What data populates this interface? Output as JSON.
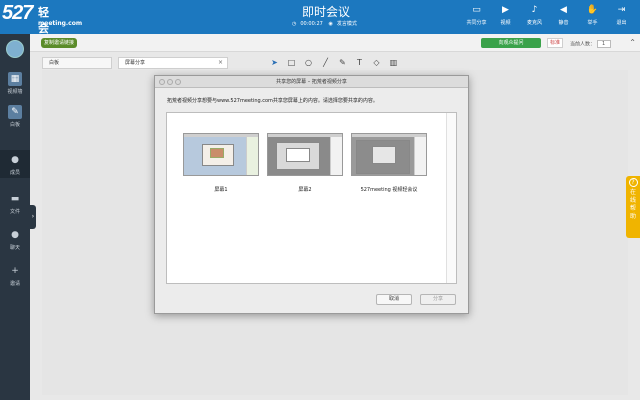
{
  "header": {
    "logo_num": "527",
    "logo_cn": "轻会议",
    "logo_url": "meeting.com",
    "title": "即时会议",
    "timer": "00:00:27",
    "mode": "发言模式",
    "tools": [
      {
        "label": "共同分享",
        "icon": "share-screen-icon"
      },
      {
        "label": "视频",
        "icon": "video-icon"
      },
      {
        "label": "麦克风",
        "icon": "mic-icon"
      },
      {
        "label": "静音",
        "icon": "speaker-icon"
      },
      {
        "label": "举手",
        "icon": "hand-icon"
      },
      {
        "label": "退出",
        "icon": "exit-icon"
      }
    ]
  },
  "toolbar2": {
    "invite": "复制邀请链接",
    "apply": "向观众提问",
    "mark": "标准",
    "online_label": "当前人数：",
    "online_count": "1"
  },
  "sidebar": {
    "items": [
      {
        "label": "视频墙",
        "icon": "grid-icon"
      },
      {
        "label": "白板",
        "icon": "pen-icon"
      },
      {
        "label": "成员",
        "icon": "user-icon"
      },
      {
        "label": "文件",
        "icon": "folder-icon"
      },
      {
        "label": "聊天",
        "icon": "chat-icon"
      },
      {
        "label": "邀请",
        "icon": "plus-icon"
      }
    ]
  },
  "tabs": [
    {
      "label": "白板"
    },
    {
      "label": "屏幕分享"
    }
  ],
  "help_tab": {
    "lines": [
      "在",
      "线",
      "帮",
      "助"
    ]
  },
  "modal": {
    "title": "共享您的屏幕 – 拓荒者视频分享",
    "description": "拓荒者视频分享想要与www.527meeting.com共享您屏幕上的内容。请选择您要共享的内容。",
    "screens": [
      {
        "label": "屏幕1"
      },
      {
        "label": "屏幕2"
      },
      {
        "label": "527meeting 视频轻会议"
      }
    ],
    "cancel": "取消",
    "share": "分享"
  }
}
